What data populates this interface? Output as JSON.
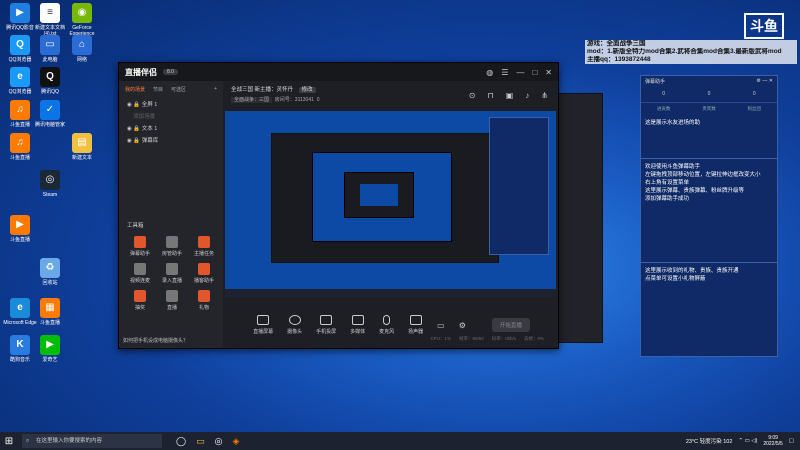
{
  "desktop": {
    "icons": [
      {
        "label": "腾讯QQ影音",
        "color": "#1f7fe0",
        "glyph": "▶"
      },
      {
        "label": "新建文本文档 (4).txt",
        "color": "#ffffff",
        "glyph": "≡"
      },
      {
        "label": "GeForce Experience",
        "color": "#76b900",
        "glyph": "◉"
      },
      {
        "label": "QQ浏览器",
        "color": "#1a9af7",
        "glyph": "Q"
      },
      {
        "label": "此电脑",
        "color": "#2a6bd4",
        "glyph": "▭"
      },
      {
        "label": "网络",
        "color": "#2a6bd4",
        "glyph": "⌂"
      },
      {
        "label": "QQ浏览器",
        "color": "#1a9af7",
        "glyph": "e"
      },
      {
        "label": "腾讯QQ",
        "color": "#111111",
        "glyph": "Q"
      },
      {
        "label": "斗鱼直播",
        "color": "#ff7a00",
        "glyph": "♫"
      },
      {
        "label": "腾讯电脑管家",
        "color": "#0b74e6",
        "glyph": "✓"
      },
      {
        "label": "斗鱼直播",
        "color": "#ff7a00",
        "glyph": "♫"
      },
      {
        "label": "新建文本",
        "color": "#f0c040",
        "glyph": "▤"
      },
      {
        "label": "Steam",
        "color": "#1b2838",
        "glyph": "◎"
      },
      {
        "label": "斗鱼直播",
        "color": "#ff7a00",
        "glyph": "▶"
      },
      {
        "label": "回收站",
        "color": "#6aa8e8",
        "glyph": "♻"
      },
      {
        "label": "Microsoft Edge",
        "color": "#1b8ad8",
        "glyph": "e"
      },
      {
        "label": "斗鱼直播",
        "color": "#ff7a00",
        "glyph": "▦"
      },
      {
        "label": "酷狗音乐",
        "color": "#2a7be0",
        "glyph": "K"
      },
      {
        "label": "爱奇艺",
        "color": "#00be06",
        "glyph": "▶"
      }
    ]
  },
  "overlay": {
    "lines": [
      "游戏：全面战争三国",
      "mod：1.新版全特力mod合集2.武将合集mod合集3.最新版武将mod",
      "主播qq：1393872448"
    ],
    "logo": "斗鱼"
  },
  "app": {
    "title": "直播伴侣",
    "version": "8.0",
    "sidebar_tabs": [
      "我的场景",
      "节目",
      "可选区"
    ],
    "scenes": [
      "全屏 1",
      "添加场景",
      "文本 1",
      "弹幕库"
    ],
    "tools_title": "工具箱",
    "tools": [
      {
        "label": "弹幕助手",
        "grey": false
      },
      {
        "label": "房管助手",
        "grey": true
      },
      {
        "label": "主播任务",
        "grey": false
      },
      {
        "label": "视频连麦",
        "grey": true
      },
      {
        "label": "录入直播",
        "grey": true
      },
      {
        "label": "播客助手",
        "grey": false
      },
      {
        "label": "抽奖",
        "grey": false
      },
      {
        "label": "直播",
        "grey": true
      },
      {
        "label": "礼物",
        "grey": false
      }
    ],
    "hint": "如何把手机设成电脑摄像头？",
    "room_title": "全战三国 新主播：灵怀丹",
    "room_tag": "修改",
    "status_category": "全面战争：三国",
    "status_room": "房间号：3113041",
    "status_count": "0",
    "controls": [
      "直播屏幕",
      "摄像头",
      "手机投屏",
      "多媒体",
      "麦克风",
      "扬声器"
    ],
    "go_live": "开始直播",
    "stats": [
      "CPU：1%",
      "帧率：60/60",
      "码率：0kb/s",
      "丢帧：0%"
    ]
  },
  "chat": {
    "title": "弹幕助手",
    "stats": [
      "0",
      "0",
      "0"
    ],
    "stat_labels": [
      "进贡数",
      "贵宾数",
      "粉丝团"
    ],
    "messages": [
      "这是展示水友进场的助",
      "欢迎使用斗鱼弹幕助手\n左键拖拽顶部移动位置，左键拉伸边框改变大小\n右上角有设置菜单\n这里展示弹幕、贵族弹幕、粉丝牌升级等\n添加弹幕助手成功",
      "这里展示收到的礼物、贵族、贵族开通\n点菜单可设置小礼物屏蔽"
    ]
  },
  "taskbar": {
    "search_placeholder": "在这里输入你要搜索的内容",
    "weather": "23°C 轻度污染 102",
    "time": "9:09",
    "date": "2022/5/5"
  }
}
